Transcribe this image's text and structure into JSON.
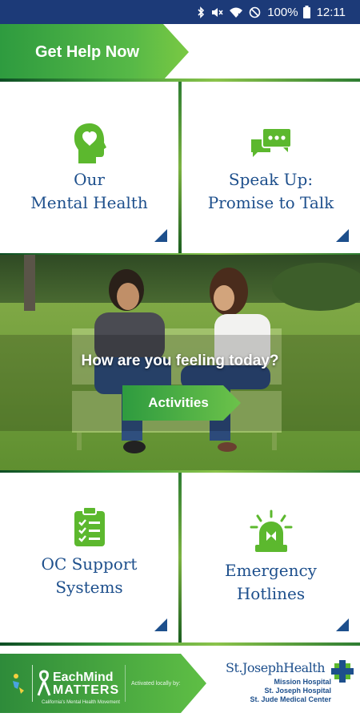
{
  "status_bar": {
    "battery": "100%",
    "time": "12:11",
    "icons": [
      "bluetooth-icon",
      "mute-icon",
      "wifi-icon",
      "do-not-disturb-icon",
      "battery-icon"
    ]
  },
  "header": {
    "help_label": "Get Help Now"
  },
  "tiles": {
    "mental_health": {
      "line1": "Our",
      "line2": "Mental Health",
      "icon": "head-heart-icon"
    },
    "speak_up": {
      "line1": "Speak Up:",
      "line2": "Promise to Talk",
      "icon": "chat-bubbles-icon"
    },
    "oc_support": {
      "line1": "OC Support",
      "line2": "Systems",
      "icon": "clipboard-checklist-icon"
    },
    "hotlines": {
      "line1": "Emergency",
      "line2": "Hotlines",
      "icon": "alarm-light-icon"
    }
  },
  "feature": {
    "question": "How are you feeling today?",
    "activities_label": "Activities"
  },
  "footer": {
    "emm_name": "EachMind",
    "emm_matters": "MATTERS",
    "emm_tagline": "California's Mental Health Movement",
    "activated": "Activated locally by:",
    "sjh_name": "St.JosephHealth",
    "hospitals": [
      "Mission Hospital",
      "St. Joseph Hospital",
      "St. Jude Medical Center"
    ]
  },
  "colors": {
    "status_bar": "#1c3a78",
    "accent_green": "#4caf50",
    "text_blue": "#1d4f8c"
  }
}
